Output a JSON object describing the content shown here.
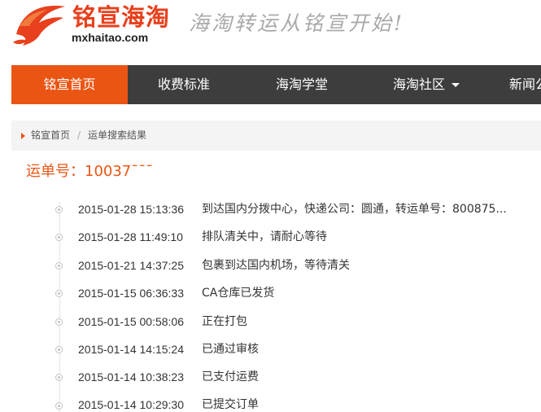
{
  "header": {
    "logo_cn": "铭宣海淘",
    "logo_domain": "mxhaitao.com",
    "slogan": "海淘转运从铭宣开始!"
  },
  "nav": {
    "items": [
      {
        "label": "铭宣首页",
        "active": true
      },
      {
        "label": "收费标准",
        "active": false
      },
      {
        "label": "海淘学堂",
        "active": false
      },
      {
        "label": "海淘社区",
        "active": false,
        "dropdown": true
      },
      {
        "label": "新闻公告",
        "active": false
      }
    ]
  },
  "breadcrumb": {
    "home": "铭宣首页",
    "separator": "/",
    "current": "运单搜索结果"
  },
  "waybill": {
    "label": "运单号：",
    "number": "10037¯¯¯"
  },
  "tracking": [
    {
      "time": "2015-01-28 15:13:36",
      "status": "到达国内分拨中心，快递公司：圆通，转运单号：800875..."
    },
    {
      "time": "2015-01-28 11:49:10",
      "status": "排队清关中，请耐心等待"
    },
    {
      "time": "2015-01-21 14:37:25",
      "status": "包裹到达国内机场，等待清关"
    },
    {
      "time": "2015-01-15 06:36:33",
      "status": "CA仓库已发货"
    },
    {
      "time": "2015-01-15 00:58:06",
      "status": "正在打包"
    },
    {
      "time": "2015-01-14 14:15:24",
      "status": "已通过审核"
    },
    {
      "time": "2015-01-14 10:38:23",
      "status": "已支付运费"
    },
    {
      "time": "2015-01-14 10:29:30",
      "status": "已提交订单"
    }
  ],
  "colors": {
    "brand": "#ea5514",
    "nav_bg": "#3d3d3d",
    "crumb_bg": "#f4f4f4"
  }
}
